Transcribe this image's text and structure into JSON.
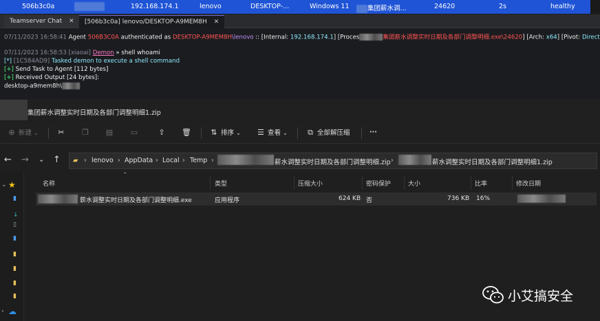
{
  "agent_row": {
    "id": "506b3c0a",
    "internal_ip": "192.168.174.1",
    "user": "lenovo",
    "computer": "DESKTOP-...",
    "os": "Windows 11",
    "process": "集团薪水调...",
    "pid": "24620",
    "sleep": "2s",
    "health": "healthy"
  },
  "tabs": [
    {
      "label": "Teamserver Chat",
      "close": "✕"
    },
    {
      "label": "[506b3c0a] lenovo/DESKTOP-A9MEM8H",
      "close": "✕"
    }
  ],
  "console": {
    "l1_time": "07/11/2023 16:58:41",
    "l1_agent_word": "Agent",
    "l1_agent_id": "506B3C0A",
    "l1_auth_text": "authenticated as",
    "l1_host": "DESKTOP-A9MEM8H",
    "l1_user": "\\lenovo",
    "l1_internal_label": ":: [Internal:",
    "l1_internal_ip": "192.168.174.1",
    "l1_process_label": "] [Proces",
    "l1_process": "集团薪水调整实时日期及各部门调整明细.exe\\24620",
    "l1_arch_label": "] [Arch:",
    "l1_arch": "x64",
    "l1_pivot_label": "] [Pivot:",
    "l1_pivot": "Direct",
    "l1_end": "]",
    "l2_time": "07/11/2023 16:58:53",
    "l2_user": "[xiaoai]",
    "l2_demon": "Demon",
    "l2_cmd": "» shell whoami",
    "l3_prefix": "[*]",
    "l3_task": "[1C584AD9]",
    "l3_text": "Tasked demon to execute a shell command",
    "l4_prefix": "[+]",
    "l4_text": "Send Task to Agent [112 bytes]",
    "l5_prefix": "[+]",
    "l5_text": "Received Output [24 bytes]:",
    "l6_text": "desktop-a9mem8h\\"
  },
  "zip_title": "集团薪水调整实时日期及各部门调整明细1.zip",
  "toolbar": {
    "new": "新建",
    "sort": "排序",
    "view": "查看",
    "extract_all": "全部解压缩",
    "more": "···"
  },
  "address": {
    "crumbs": [
      "lenovo",
      "AppData",
      "Local",
      "Temp",
      "薪水调整实时日期及各部门调整明细.zip",
      "薪水调整实时日期及各部门调整明细1.zip"
    ],
    "sep": "›"
  },
  "columns": [
    "名称",
    "类型",
    "压缩大小",
    "密码保护",
    "大小",
    "比率",
    "修改日期"
  ],
  "files": [
    {
      "name": "薪水调整实时日期及各部门调整明细.exe",
      "type": "应用程序",
      "compressed": "624 KB",
      "password": "否",
      "size": "736 KB",
      "ratio": "16%"
    }
  ],
  "watermark": "小艾搞安全",
  "colors": {
    "accent_blue": "#1f54d6",
    "console_red": "#ff5555",
    "console_cyan": "#8be9fd",
    "console_green": "#50fa7b",
    "console_purple": "#bd93f9"
  }
}
